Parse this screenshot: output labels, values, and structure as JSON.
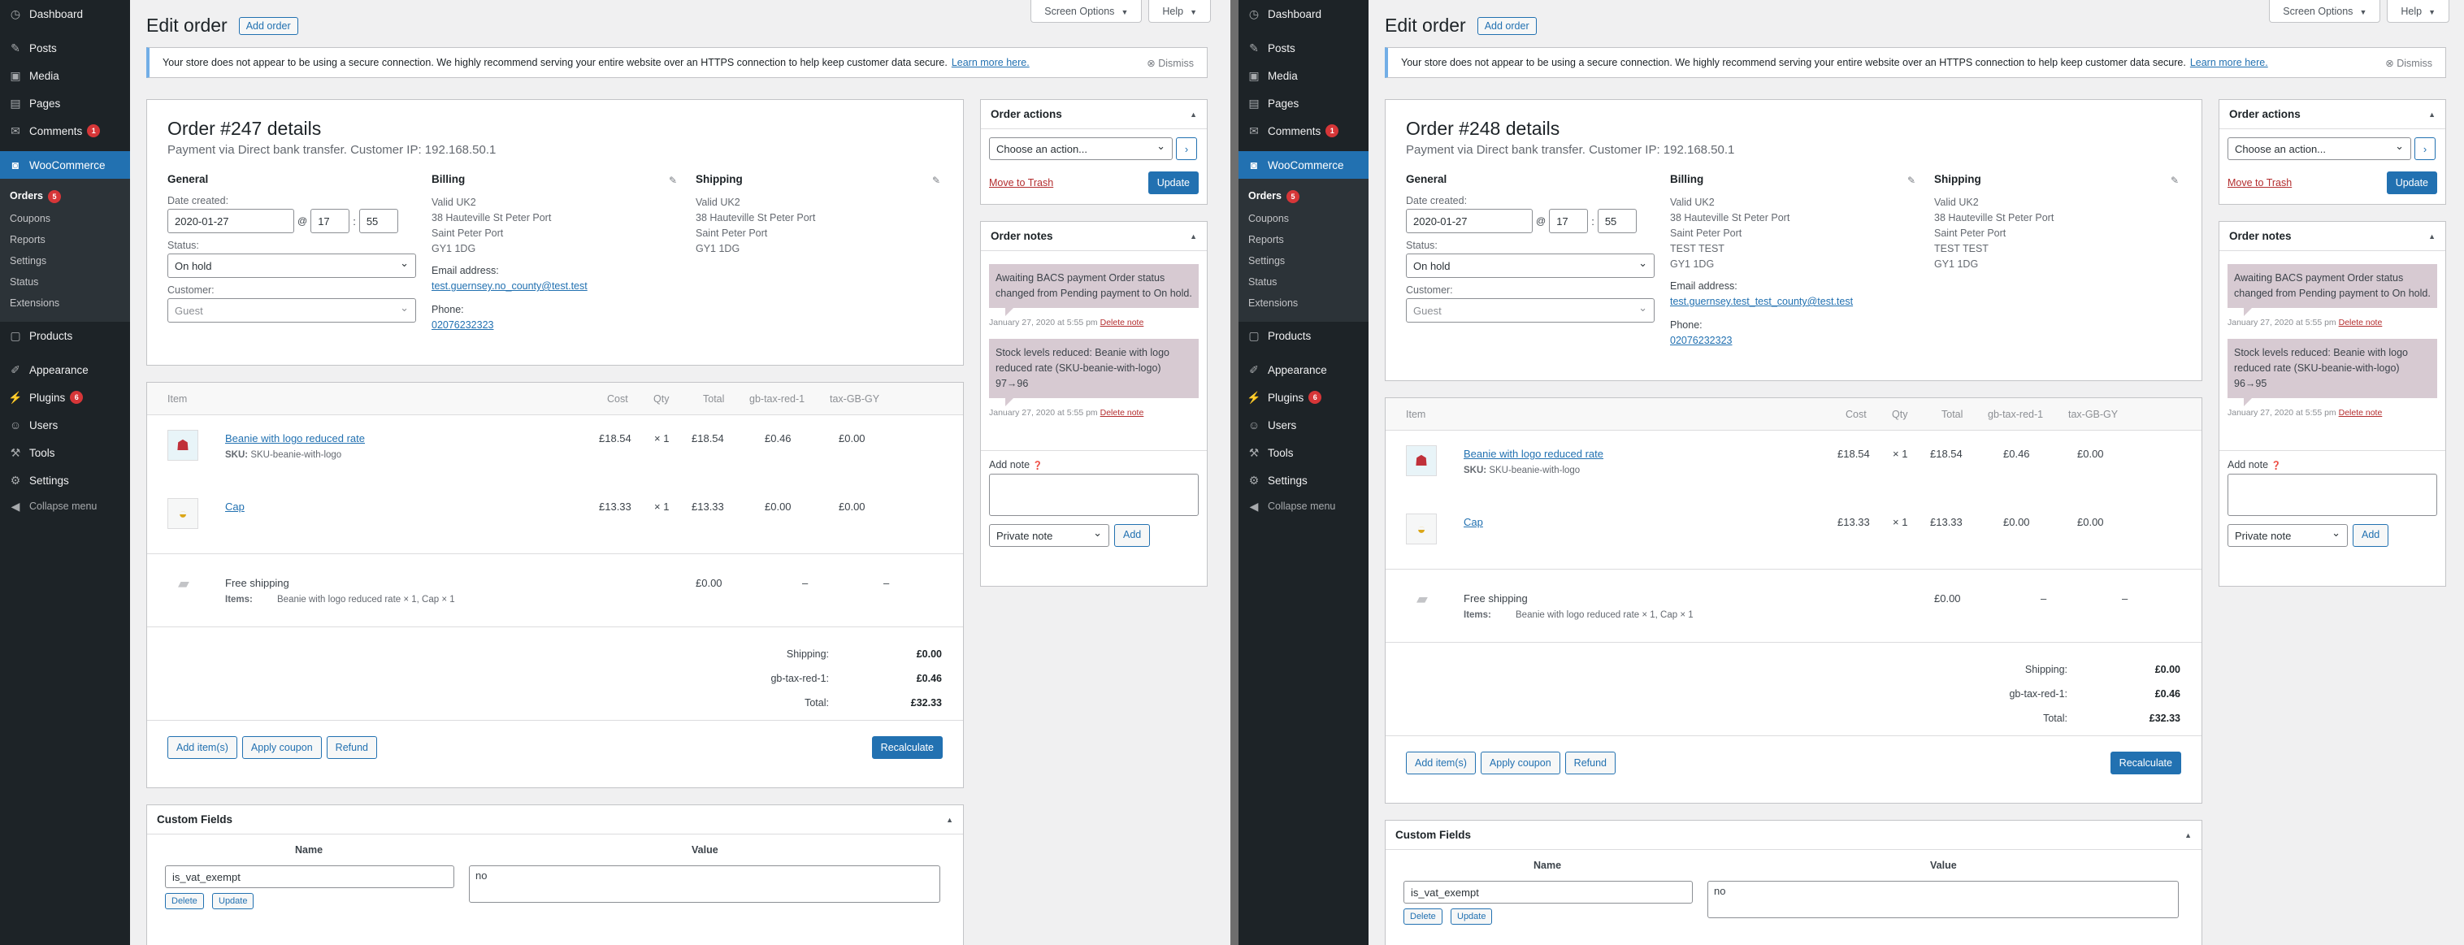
{
  "menu": {
    "dashboard": "Dashboard",
    "posts": "Posts",
    "media": "Media",
    "pages": "Pages",
    "comments": "Comments",
    "comments_count": "1",
    "woocommerce": "WooCommerce",
    "orders": "Orders",
    "orders_count": "5",
    "coupons": "Coupons",
    "reports": "Reports",
    "settings_sub": "Settings",
    "status": "Status",
    "extensions": "Extensions",
    "products": "Products",
    "appearance": "Appearance",
    "plugins": "Plugins",
    "plugins_count": "6",
    "users": "Users",
    "tools": "Tools",
    "settings": "Settings",
    "collapse": "Collapse menu"
  },
  "top": {
    "screen_options": "Screen Options",
    "help": "Help"
  },
  "page": {
    "title": "Edit order",
    "add_order": "Add order"
  },
  "notice": {
    "text": "Your store does not appear to be using a secure connection. We highly recommend serving your entire website over an HTTPS connection to help keep customer data secure.",
    "link": "Learn more here.",
    "dismiss": "Dismiss"
  },
  "labels": {
    "general": "General",
    "billing": "Billing",
    "shipping": "Shipping",
    "date_created": "Date created:",
    "at": "@",
    "status": "Status:",
    "customer": "Customer:",
    "email": "Email address:",
    "phone": "Phone:",
    "item": "Item",
    "cost": "Cost",
    "qty": "Qty",
    "total": "Total",
    "tax1": "gb-tax-red-1",
    "tax2": "tax-GB-GY",
    "sku_label": "SKU:",
    "items_label": "Items:",
    "shipping_total": "Shipping:",
    "tax_total": "gb-tax-red-1:",
    "order_total": "Total:",
    "add_items": "Add item(s)",
    "apply_coupon": "Apply coupon",
    "refund": "Refund",
    "recalculate": "Recalculate",
    "custom_fields": "Custom Fields",
    "name": "Name",
    "value": "Value",
    "delete": "Delete",
    "update_small": "Update",
    "order_actions": "Order actions",
    "choose_action": "Choose an action...",
    "move_to_trash": "Move to Trash",
    "update": "Update",
    "order_notes": "Order notes",
    "add_note": "Add note",
    "private_note": "Private note",
    "add": "Add",
    "delete_note": "Delete note"
  },
  "orders": [
    {
      "title": "Order #247 details",
      "subtitle": "Payment via Direct bank transfer. Customer IP: 192.168.50.1",
      "date": "2020-01-27",
      "hour": "17",
      "minute": "55",
      "status": "On hold",
      "customer": "Guest",
      "billing": [
        "Valid UK2",
        "38 Hauteville St Peter Port",
        "Saint Peter Port",
        "GY1 1DG"
      ],
      "shipping": [
        "Valid UK2",
        "38 Hauteville St Peter Port",
        "Saint Peter Port",
        "GY1 1DG"
      ],
      "email": "test.guernsey.no_county@test.test",
      "phone": "02076232323",
      "items": [
        {
          "name": "Beanie with logo reduced rate",
          "sku": "SKU-beanie-with-logo",
          "cost": "£18.54",
          "qty": "× 1",
          "total": "£18.54",
          "tax1": "£0.46",
          "tax2": "£0.00",
          "icon": "beanie-thumbnail"
        },
        {
          "name": "Cap",
          "sku": "",
          "cost": "£13.33",
          "qty": "× 1",
          "total": "£13.33",
          "tax1": "£0.00",
          "tax2": "£0.00",
          "icon": "cap-thumbnail"
        }
      ],
      "ship_line": {
        "name": "Free shipping",
        "items": "Beanie with logo reduced rate × 1, Cap × 1",
        "total": "£0.00",
        "tax1": "–",
        "tax2": "–"
      },
      "totals": {
        "shipping": "£0.00",
        "tax": "£0.46",
        "total": "£32.33"
      },
      "custom_field": {
        "name": "is_vat_exempt",
        "value": "no"
      },
      "notes": [
        {
          "text": "Awaiting BACS payment Order status changed from Pending payment to On hold.",
          "meta": "January 27, 2020 at 5:55 pm"
        },
        {
          "text": "Stock levels reduced: Beanie with logo reduced rate (SKU-beanie-with-logo) 97→96",
          "meta": "January 27, 2020 at 5:55 pm"
        }
      ]
    },
    {
      "title": "Order #248 details",
      "subtitle": "Payment via Direct bank transfer. Customer IP: 192.168.50.1",
      "date": "2020-01-27",
      "hour": "17",
      "minute": "55",
      "status": "On hold",
      "customer": "Guest",
      "billing": [
        "Valid UK2",
        "38 Hauteville St Peter Port",
        "Saint Peter Port",
        "TEST TEST",
        "GY1 1DG"
      ],
      "shipping": [
        "Valid UK2",
        "38 Hauteville St Peter Port",
        "Saint Peter Port",
        "TEST TEST",
        "GY1 1DG"
      ],
      "email": "test.guernsey.test_test_county@test.test",
      "phone": "02076232323",
      "items": [
        {
          "name": "Beanie with logo reduced rate",
          "sku": "SKU-beanie-with-logo",
          "cost": "£18.54",
          "qty": "× 1",
          "total": "£18.54",
          "tax1": "£0.46",
          "tax2": "£0.00",
          "icon": "beanie-thumbnail"
        },
        {
          "name": "Cap",
          "sku": "",
          "cost": "£13.33",
          "qty": "× 1",
          "total": "£13.33",
          "tax1": "£0.00",
          "tax2": "£0.00",
          "icon": "cap-thumbnail"
        }
      ],
      "ship_line": {
        "name": "Free shipping",
        "items": "Beanie with logo reduced rate × 1, Cap × 1",
        "total": "£0.00",
        "tax1": "–",
        "tax2": "–"
      },
      "totals": {
        "shipping": "£0.00",
        "tax": "£0.46",
        "total": "£32.33"
      },
      "custom_field": {
        "name": "is_vat_exempt",
        "value": "no"
      },
      "notes": [
        {
          "text": "Awaiting BACS payment Order status changed from Pending payment to On hold.",
          "meta": "January 27, 2020 at 5:55 pm"
        },
        {
          "text": "Stock levels reduced: Beanie with logo reduced rate (SKU-beanie-with-logo) 96→95",
          "meta": "January 27, 2020 at 5:55 pm"
        }
      ]
    }
  ]
}
